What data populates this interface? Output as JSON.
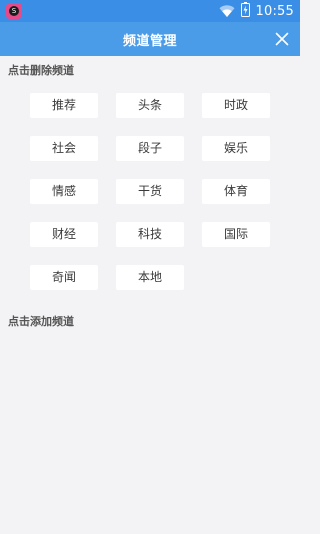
{
  "status_bar": {
    "time": "10:55",
    "app_icon_glyph": "S",
    "icons": [
      "app-notification-icon",
      "wifi-icon",
      "battery-charging-icon"
    ],
    "color": "#3a8ee6"
  },
  "header": {
    "title": "频道管理",
    "close_icon": "close-icon",
    "color": "#4a9ce9"
  },
  "sections": {
    "delete_label": "点击删除频道",
    "add_label": "点击添加频道"
  },
  "channels": [
    "推荐",
    "头条",
    "时政",
    "社会",
    "段子",
    "娱乐",
    "情感",
    "干货",
    "体育",
    "财经",
    "科技",
    "国际",
    "奇闻",
    "本地"
  ]
}
